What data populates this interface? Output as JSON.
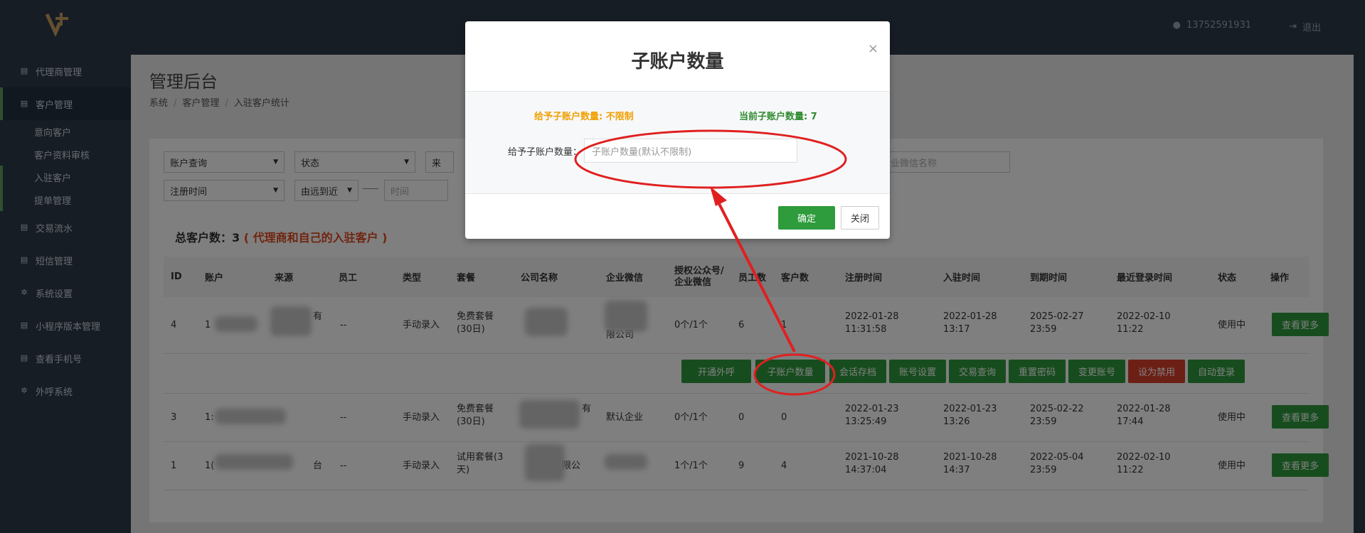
{
  "header": {
    "phone": "13752591931",
    "logout": "退出"
  },
  "sidebar": {
    "items": [
      {
        "label": "代理商管理"
      },
      {
        "label": "客户管理"
      },
      {
        "label": "交易流水"
      },
      {
        "label": "短信管理"
      },
      {
        "label": "系统设置"
      },
      {
        "label": "小程序版本管理"
      },
      {
        "label": "查看手机号"
      },
      {
        "label": "外呼系统"
      }
    ],
    "sub_items": [
      {
        "label": "意向客户"
      },
      {
        "label": "客户资料审核"
      },
      {
        "label": "入驻客户"
      },
      {
        "label": "提单管理"
      }
    ]
  },
  "page": {
    "title": "管理后台",
    "breadcrumb": [
      "系统",
      "客户管理",
      "入驻客户统计"
    ]
  },
  "filters": {
    "account_query": "账户查询",
    "status": "状态",
    "source_fragment": "来",
    "wechat_name_placeholder": "企业微信名称",
    "reg_time": "注册时间",
    "order": "由远到近",
    "time_placeholder": "时间"
  },
  "summary": {
    "label": "总客户数：3",
    "note": "( 代理商和自己的入驻客户 )"
  },
  "table": {
    "headers": [
      "ID",
      "账户",
      "来源",
      "员工",
      "类型",
      "套餐",
      "公司名称",
      "企业微信",
      "授权公众号/企业微信",
      "员工数",
      "客户数",
      "注册时间",
      "入驻时间",
      "到期时间",
      "最近登录时间",
      "状态",
      "操作"
    ],
    "rows": [
      {
        "id": "4",
        "account": "1",
        "source": "有",
        "employee": "--",
        "type": "手动录入",
        "plan": "免费套餐(30日)",
        "company": "",
        "wechat": "限公司",
        "auth": "0个/1个",
        "staff": "6",
        "customers": "1",
        "reg": "2022-01-28 11:31:58",
        "join": "2022-01-28 13:17",
        "expire": "2025-02-27 23:59",
        "last": "2022-02-10 11:22",
        "status": "使用中",
        "op": "查看更多"
      },
      {
        "id": "3",
        "account": "1:",
        "source": "",
        "employee": "--",
        "type": "手动录入",
        "plan": "免费套餐(30日)",
        "company": "有",
        "wechat": "默认企业",
        "auth": "0个/1个",
        "staff": "0",
        "customers": "0",
        "reg": "2022-01-23 13:25:49",
        "join": "2022-01-23 13:26",
        "expire": "2025-02-22 23:59",
        "last": "2022-01-28 17:44",
        "status": "使用中",
        "op": "查看更多"
      },
      {
        "id": "1",
        "account": "1(",
        "source": "台",
        "employee": "--",
        "type": "手动录入",
        "plan": "试用套餐(3天)",
        "company": "限公",
        "wechat": "",
        "auth": "1个/1个",
        "staff": "9",
        "customers": "4",
        "reg": "2021-10-28 14:37:04",
        "join": "2021-10-28 14:37",
        "expire": "2022-05-04 23:59",
        "last": "2022-02-10 11:22",
        "status": "使用中",
        "op": "查看更多"
      }
    ],
    "actions": [
      "开通外呼",
      "子账户数量",
      "会话存档",
      "账号设置",
      "交易查询",
      "重置密码",
      "变更账号",
      "设为禁用",
      "自动登录"
    ]
  },
  "modal": {
    "title": "子账户数量",
    "close": "×",
    "give_limit": "给予子账户数量: 不限制",
    "current": "当前子账户数量: 7",
    "field_label": "给予子账户数量：",
    "field_placeholder": "子账户数量(默认不限制)",
    "ok": "确定",
    "close_btn": "关闭"
  },
  "colors": {
    "accent": "#2e9b3c",
    "danger": "#d9412b",
    "warning": "#f0a000",
    "sidebar": "#2f3a4a"
  }
}
